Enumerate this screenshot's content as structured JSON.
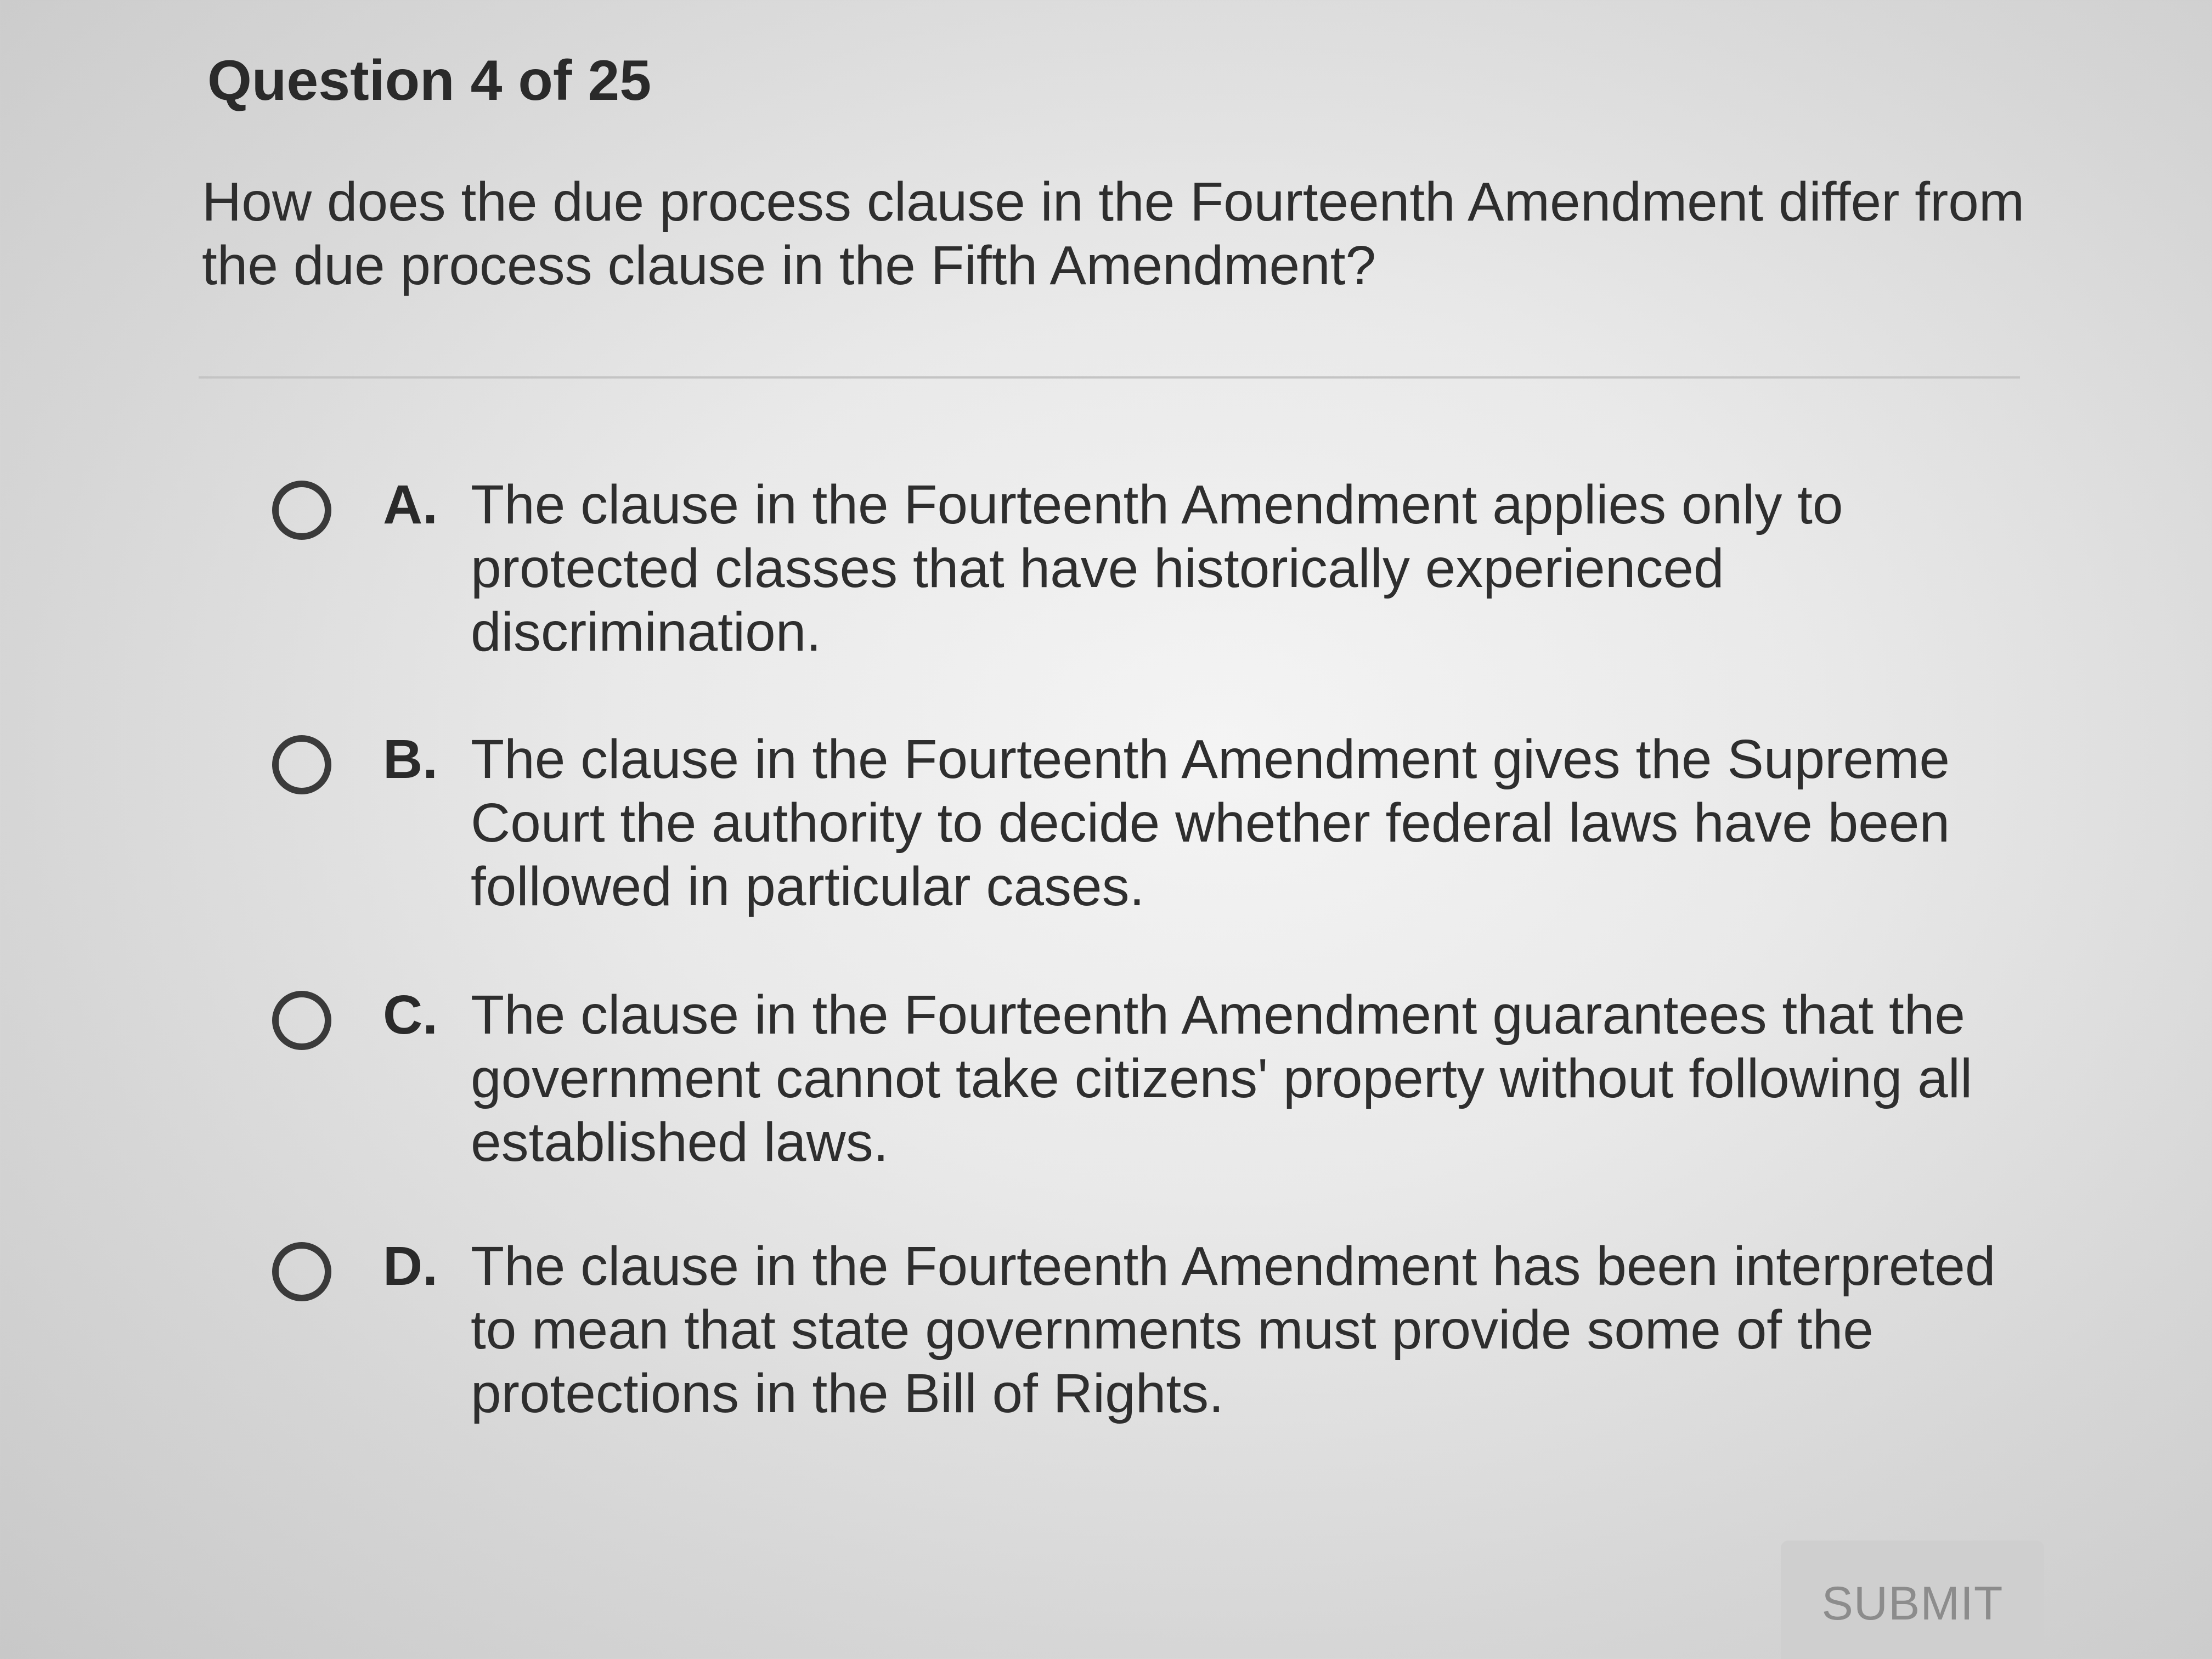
{
  "header": {
    "question_counter": "Question 4 of 25"
  },
  "question": {
    "text": "How does the due process clause in the Fourteenth Amendment differ from the due process clause in the Fifth Amendment?"
  },
  "options": [
    {
      "letter": "A.",
      "text": "The clause in the Fourteenth Amendment applies only to protected classes that have historically experienced discrimination."
    },
    {
      "letter": "B.",
      "text": "The clause in the Fourteenth Amendment gives the Supreme Court the authority to decide whether federal laws have been followed in particular cases."
    },
    {
      "letter": "C.",
      "text": "The clause in the Fourteenth Amendment guarantees that the government cannot take citizens' property without following all established laws."
    },
    {
      "letter": "D.",
      "text": "The clause in the Fourteenth Amendment has been interpreted to mean that state governments must provide some of the protections in the Bill of Rights."
    }
  ],
  "actions": {
    "submit_label": "SUBMIT"
  }
}
